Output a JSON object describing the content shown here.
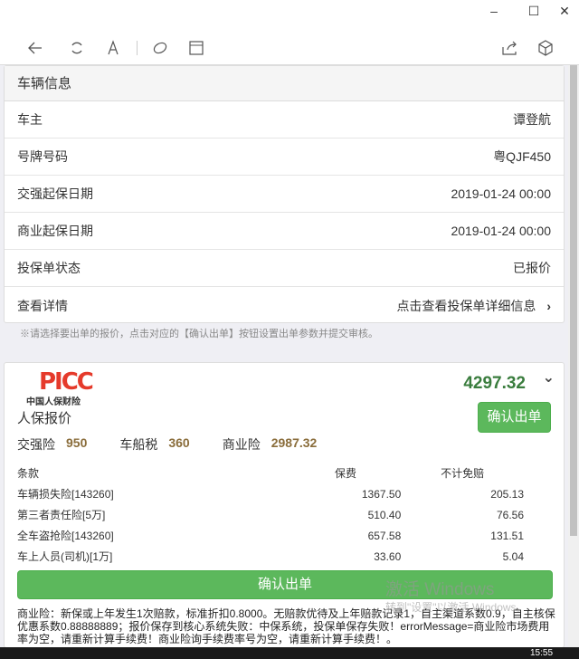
{
  "window": {
    "minimize": "–",
    "maximize": "☐",
    "close": "✕"
  },
  "panel": {
    "title": "车辆信息",
    "rows": [
      {
        "label": "车主",
        "value": "谭登航"
      },
      {
        "label": "号牌号码",
        "value": "粤QJF450"
      },
      {
        "label": "交强起保日期",
        "value": "2019-01-24 00:00"
      },
      {
        "label": "商业起保日期",
        "value": "2019-01-24 00:00"
      },
      {
        "label": "投保单状态",
        "value": "已报价"
      },
      {
        "label": "查看详情",
        "value": "点击查看投保单详细信息"
      }
    ]
  },
  "note": "※请选择要出单的报价，点击对应的【确认出单】按钮设置出单参数并提交审核。",
  "quote": {
    "logo_text": "PICC",
    "logo_sub": "中国人保财险",
    "title": "人保报价",
    "total": "4297.32",
    "confirm": "确认出单",
    "sums": [
      {
        "label": "交强险",
        "value": "950"
      },
      {
        "label": "车船税",
        "value": "360"
      },
      {
        "label": "商业险",
        "value": "2987.32"
      }
    ],
    "headers": [
      "条款",
      "保费",
      "不计免赔"
    ],
    "rows": [
      [
        "车辆损失险[143260]",
        "1367.50",
        "205.13"
      ],
      [
        "第三者责任险[5万]",
        "510.40",
        "76.56"
      ],
      [
        "全车盗抢险[143260]",
        "657.58",
        "131.51"
      ],
      [
        "车上人员(司机)[1万]",
        "33.60",
        "5.04"
      ]
    ],
    "message": "商业险：新保或上年发生1次赔款，标准折扣0.8000。无赔款优待及上年赔款记录1，自主渠道系数0.9，自主核保优惠系数0.88888889；报价保存到核心系统失败：中保系统，投保单保存失败！errorMessage=商业险市场费用率为空，请重新计算手续费！商业险询手续费率号为空，请重新计算手续费！。"
  },
  "watermark": {
    "line1": "激活 Windows",
    "line2": "转到\"设置\"以激活 Windows。"
  },
  "taskbar": {
    "time": "15:55"
  }
}
